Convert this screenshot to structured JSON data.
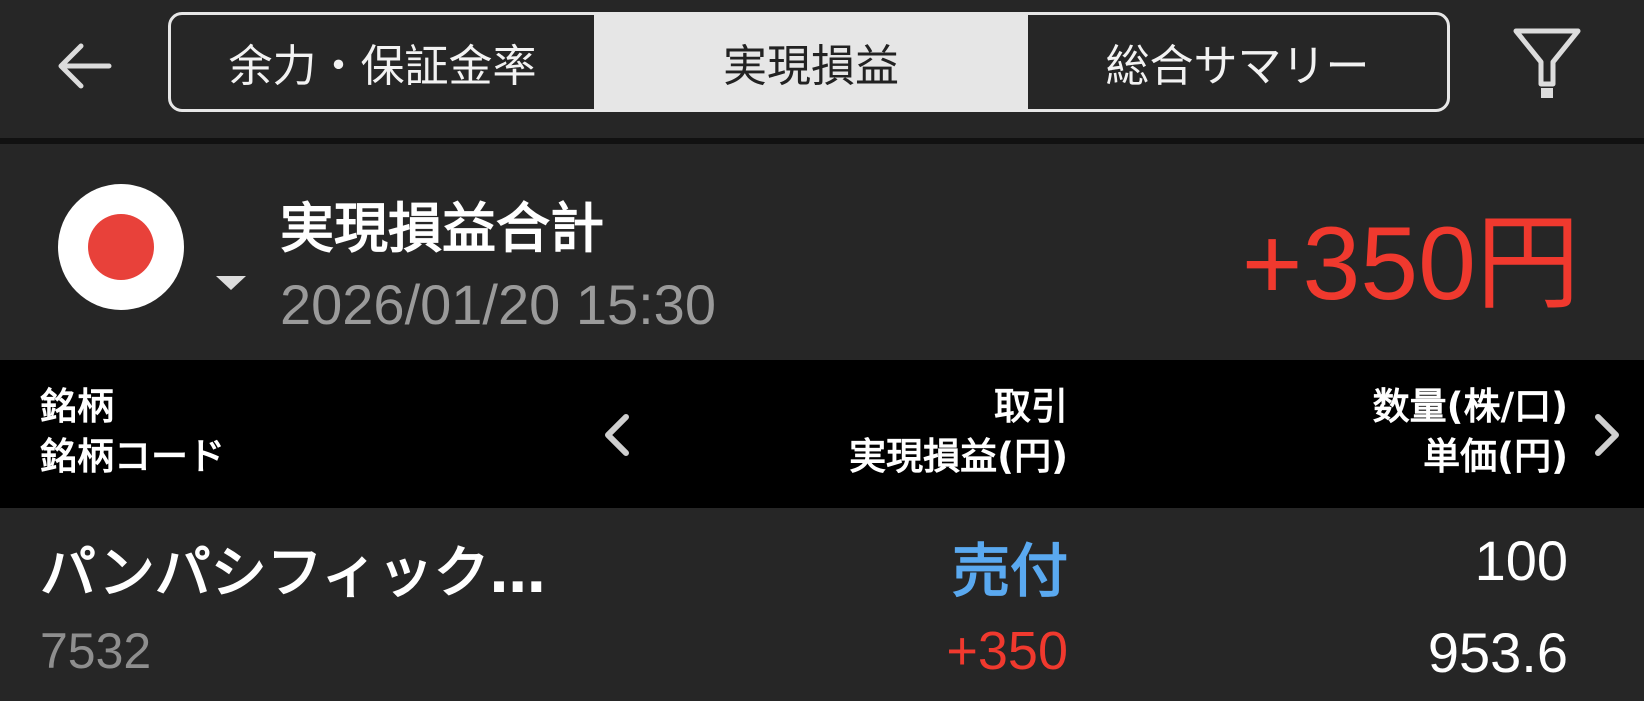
{
  "header": {
    "tabs": [
      {
        "label": "余力・保証金率",
        "active": false
      },
      {
        "label": "実現損益",
        "active": true
      },
      {
        "label": "総合サマリー",
        "active": false
      }
    ]
  },
  "summary": {
    "title": "実現損益合計",
    "datetime": "2026/01/20  15:30",
    "total": "+350円"
  },
  "table": {
    "columns": {
      "left": [
        "銘柄",
        "銘柄コード"
      ],
      "middle": [
        "取引",
        "実現損益(円)"
      ],
      "right": [
        "数量(株/口)",
        "単価(円)"
      ]
    },
    "rows": [
      {
        "name": "パンパシフィック…",
        "code": "7532",
        "trade": "売付",
        "pnl": "+350",
        "quantity": "100",
        "price": "953.6"
      }
    ]
  },
  "colors": {
    "background": "#252525",
    "accent_red": "#f0392e",
    "accent_blue": "#5aa9f0",
    "active_tab": "#e6e6e6",
    "table_header": "#000000"
  },
  "icons": {
    "back": "arrow-left-icon",
    "filter": "filter-icon",
    "flag": "japan-flag-icon",
    "prev": "chevron-left-icon",
    "next": "chevron-right-icon",
    "dropdown": "caret-down-icon"
  }
}
